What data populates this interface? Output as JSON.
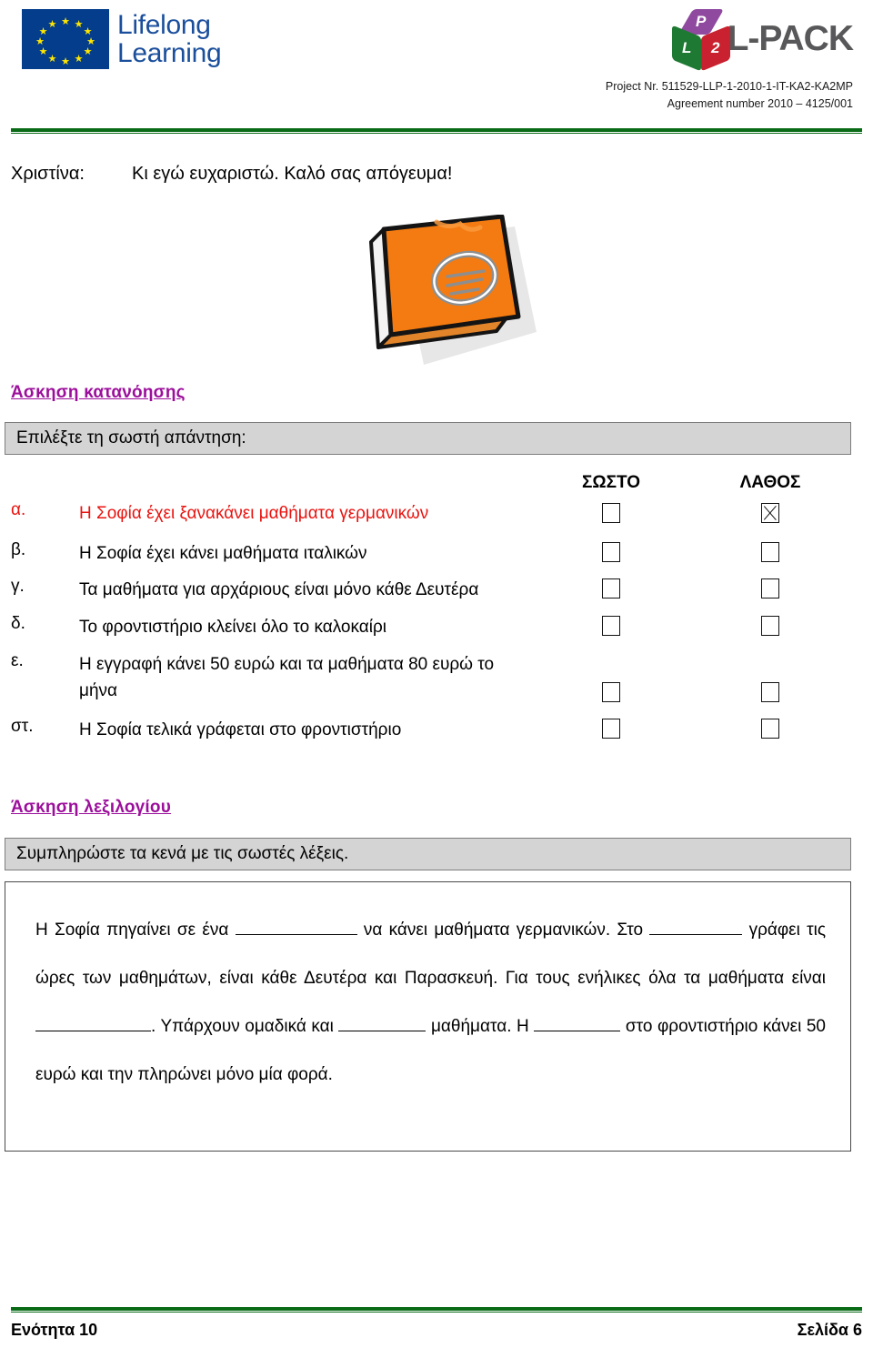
{
  "header": {
    "eu_logo": {
      "line1": "Lifelong",
      "line2": "Learning",
      "icon": "eu-flag-icon"
    },
    "lpack_logo": {
      "cube_top_letter": "P",
      "cube_left_letter": "L",
      "cube_right_letter": "2",
      "wordmark": "L-PACK"
    },
    "project_line1": "Project Nr. 511529-LLP-1-2010-1-IT-KA2-KA2MP",
    "project_line2": "Agreement number 2010 – 4125/001"
  },
  "dialogue": {
    "speaker": "Χριστίνα:",
    "text": "Κι εγώ ευχαριστώ. Καλό σας απόγευμα!"
  },
  "book_image": {
    "alt": "orange-book-icon"
  },
  "comprehension": {
    "heading": "Άσκηση κατανόησης",
    "instruction": "Επιλέξτε τη σωστή απάντηση:",
    "col_true": "ΣΩΣΤΟ",
    "col_false": "ΛΑΘΟΣ",
    "items": [
      {
        "letter": "α.",
        "text": "Η Σοφία έχει ξανακάνει μαθήματα γερμανικών",
        "true_checked": false,
        "false_checked": true,
        "color": "#e8130f"
      },
      {
        "letter": "β.",
        "text": "Η Σοφία έχει κάνει μαθήματα ιταλικών",
        "true_checked": false,
        "false_checked": false,
        "color": "#000000"
      },
      {
        "letter": "γ.",
        "text": "Τα μαθήματα για αρχάριους είναι μόνο κάθε Δευτέρα",
        "true_checked": false,
        "false_checked": false,
        "color": "#000000"
      },
      {
        "letter": "δ.",
        "text": "Το φροντιστήριο κλείνει όλο το καλοκαίρι",
        "true_checked": false,
        "false_checked": false,
        "color": "#000000"
      },
      {
        "letter": "ε.",
        "text": "Η εγγραφή κάνει 50 ευρώ και τα μαθήματα 80 ευρώ το μήνα",
        "true_checked": false,
        "false_checked": false,
        "color": "#000000"
      },
      {
        "letter": "στ.",
        "text": "Η Σοφία τελικά γράφεται στο φροντιστήριο",
        "true_checked": false,
        "false_checked": false,
        "color": "#000000"
      }
    ]
  },
  "vocabulary": {
    "heading": "Άσκηση λεξιλογίου",
    "instruction": "Συμπληρώστε τα κενά με τις σωστές λέξεις.",
    "cloze": {
      "s1": "Η Σοφία πηγαίνει σε ένα",
      "s2": "να κάνει μαθήματα γερμανικών. Στο",
      "s3": "γράφει τις ώρες των μαθημάτων, είναι κάθε Δευτέρα και Παρασκευή. Για τους ενήλικες όλα τα μαθήματα είναι",
      "s4": ". Υπάρχουν ομαδικά και",
      "s5": "μαθήματα. Η",
      "s6": "στο φροντιστήριο κάνει 50 ευρώ και την πληρώνει μόνο μία φορά."
    }
  },
  "footer": {
    "unit": "Ενότητα 10",
    "page": "Σελίδα 6"
  },
  "colors": {
    "rule_green": "#0a6b17",
    "heading_purple": "#9c0f9c",
    "highlight_red": "#e8130f",
    "band_gray": "#d4d4d4",
    "eu_blue": "#043d8c",
    "book_orange": "#f47b11"
  }
}
